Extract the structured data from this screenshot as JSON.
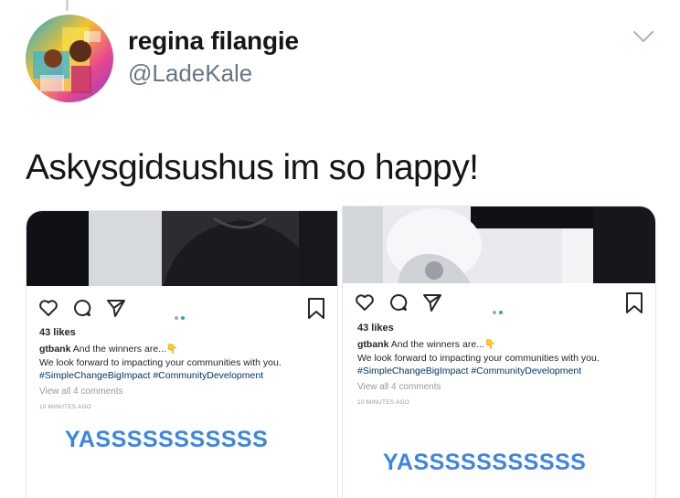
{
  "tweet": {
    "display_name": "regina filangie",
    "handle": "@LadeKale",
    "text": "Askysgidsushus im so happy!"
  },
  "posts": [
    {
      "likes": "43 likes",
      "username": "gtbank",
      "caption_line1": "And the winners are...👇",
      "caption_line2": "We look forward to impacting your communities with you.",
      "hashtags": "#SimpleChangeBigImpact #CommunityDevelopment",
      "view_comments": "View all 4 comments",
      "time_ago": "10 MINUTES AGO",
      "reaction": "YASSSSSSSSSSS"
    },
    {
      "likes": "43 likes",
      "username": "gtbank",
      "caption_line1": "And the winners are...👇",
      "caption_line2": "We look forward to impacting your communities with you.",
      "hashtags": "#SimpleChangeBigImpact #CommunityDevelopment",
      "view_comments": "View all 4 comments",
      "time_ago": "10 MINUTES AGO",
      "reaction": "YASSSSSSSSSSS"
    }
  ],
  "colors": {
    "name": "#14171a",
    "handle": "#657786",
    "reaction": "#3a86e8",
    "hashtag": "#003569",
    "carousel_active": "#3897f0",
    "carousel_inactive": "#a8a8a8"
  }
}
